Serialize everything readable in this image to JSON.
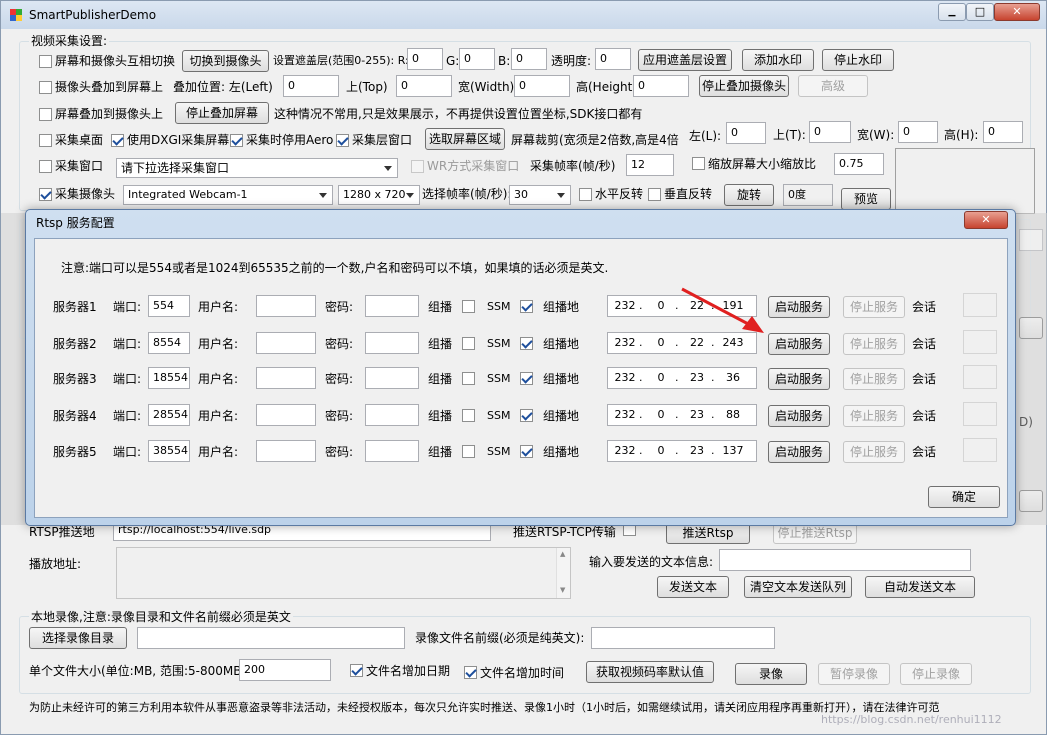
{
  "app": {
    "title": "SmartPublisherDemo"
  },
  "window_controls": {
    "minimize": "▁",
    "maximize": "□",
    "close": "✕"
  },
  "capture": {
    "group_label": "视频采集设置:",
    "r1": {
      "switch_cb": "屏幕和摄像头互相切换",
      "switch_btn": "切换到摄像头",
      "mask_label": "设置遮盖层(范围0-255): R:",
      "r_val": "0",
      "g_label": "G:",
      "g_val": "0",
      "b_label": "B:",
      "b_val": "0",
      "alpha_label": "透明度:",
      "alpha_val": "0",
      "apply_btn": "应用遮盖层设置",
      "add_wm_btn": "添加水印",
      "stop_wm_btn": "停止水印"
    },
    "r2": {
      "cam_over_screen_cb": "摄像头叠加到屏幕上",
      "pos_label": "叠加位置: 左(Left)",
      "left_val": "0",
      "top_label": "上(Top)",
      "top_val": "0",
      "width_label": "宽(Width)",
      "width_val": "0",
      "height_label": "高(Height)",
      "height_val": "0",
      "stop_cam_btn": "停止叠加摄像头",
      "advanced_btn": "高级"
    },
    "r3": {
      "screen_over_cam_cb": "屏幕叠加到摄像头上",
      "stop_screen_btn": "停止叠加屏幕",
      "note": "这种情况不常用,只是效果展示，不再提供设置位置坐标,SDK接口都有"
    },
    "r4": {
      "desktop_cb": "采集桌面",
      "dxgi_cb": "使用DXGI采集屏幕",
      "aero_cb": "采集时停用Aero",
      "layered_cb": "采集层窗口",
      "select_region_btn": "选取屏幕区域",
      "crop_label": "屏幕裁剪(宽须是2倍数,高是4倍",
      "l_label": "左(L):",
      "l_val": "0",
      "t_label": "上(T):",
      "t_val": "0",
      "w_label": "宽(W):",
      "w_val": "0",
      "h_label": "高(H):",
      "h_val": "0"
    },
    "r5": {
      "window_cb": "采集窗口",
      "window_select": "请下拉选择采集窗口",
      "wr_cb": "WR方式采集窗口",
      "fps_label": "采集帧率(帧/秒)",
      "fps_val": "12",
      "scale_cb": "缩放屏幕大小缩放比",
      "scale_val": "0.75"
    },
    "r6": {
      "camera_cb": "采集摄像头",
      "camera_select": "Integrated Webcam-1",
      "res_select": "1280 x 720",
      "cam_fps_label": "选择帧率(帧/秒):",
      "cam_fps_select": "30",
      "hflip_cb": "水平反转",
      "vflip_cb": "垂直反转",
      "rotate_btn": "旋转",
      "rotate_val": "0度",
      "preview_btn": "预览"
    }
  },
  "dialog": {
    "title": "Rtsp 服务配置",
    "close": "✕",
    "note": "注意:端口可以是554或者是1024到65535之前的一个数,户名和密码可以不填，如果填的话必须是英文.",
    "port_label": "端口:",
    "user_label": "用户名:",
    "pass_label": "密码:",
    "multicast_label": "组播",
    "ssm_label": "SSM",
    "maddr_label": "组播地",
    "start_label": "启动服务",
    "stop_label": "停止服务",
    "session_label": "会话",
    "ok_btn": "确定",
    "servers": [
      {
        "name": "服务器1",
        "port": "554",
        "ip": [
          "232",
          "0",
          "22",
          "191"
        ]
      },
      {
        "name": "服务器2",
        "port": "8554",
        "ip": [
          "232",
          "0",
          "22",
          "243"
        ]
      },
      {
        "name": "服务器3",
        "port": "18554",
        "ip": [
          "232",
          "0",
          "23",
          "36"
        ]
      },
      {
        "name": "服务器4",
        "port": "28554",
        "ip": [
          "232",
          "0",
          "23",
          "88"
        ]
      },
      {
        "name": "服务器5",
        "port": "38554",
        "ip": [
          "232",
          "0",
          "23",
          "137"
        ]
      }
    ]
  },
  "push": {
    "rtsp_push_label": "RTSP推送地",
    "rtsp_url": "rtsp://localhost:554/live.sdp",
    "rtsp_tcp_label": "推送RTSP-TCP传输",
    "push_rtsp_btn": "推送Rtsp",
    "stop_push_rtsp_btn": "停止推送Rtsp",
    "play_label": "播放地址:",
    "text_label": "输入要发送的文本信息:",
    "send_text_btn": "发送文本",
    "clear_queue_btn": "清空文本发送队列",
    "auto_send_btn": "自动发送文本"
  },
  "record": {
    "group_label": "本地录像,注意:录像目录和文件名前缀必须是英文",
    "choose_dir_btn": "选择录像目录",
    "prefix_label": "录像文件名前缀(必须是纯英文):",
    "size_label": "单个文件大小(单位:MB, 范围:5-800MB):",
    "size_val": "200",
    "add_date_cb": "文件名增加日期",
    "add_time_cb": "文件名增加时间",
    "get_bitrate_btn": "获取视频码率默认值",
    "record_btn": "录像",
    "pause_btn": "暂停录像",
    "stop_btn": "停止录像"
  },
  "footer": {
    "notice": "为防止未经许可的第三方利用本软件从事恶意盗录等非法活动，未经授权版本，每次只允许实时推送、录像1小时（1小时后，如需继续试用，请关闭应用程序再重新打开），请在法律许可范",
    "watermark": "https://blog.csdn.net/renhui1112"
  }
}
